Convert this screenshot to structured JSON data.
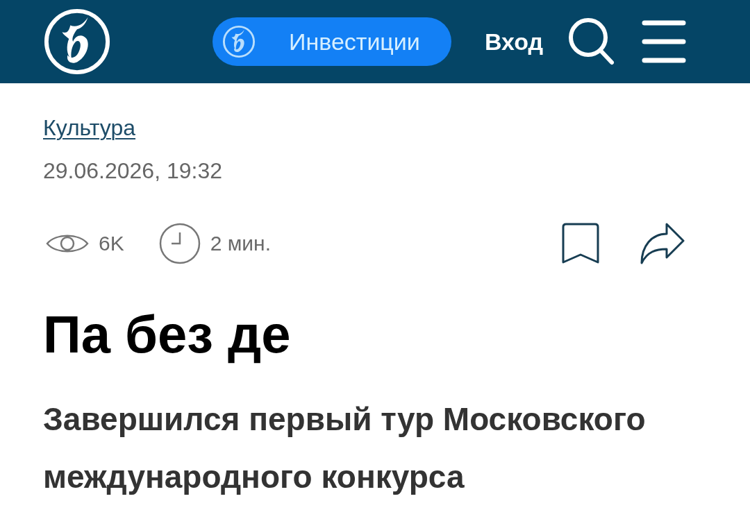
{
  "header": {
    "investments_button": {
      "label": "Инвестиции"
    },
    "login_link": "Вход"
  },
  "article": {
    "category": "Культура",
    "datetime": "29.06.2026, 19:32",
    "views": "6K",
    "read_time": "2 мин.",
    "title": "Па без де",
    "subtitle": "Завершился первый тур Московского международного конкурса"
  }
}
